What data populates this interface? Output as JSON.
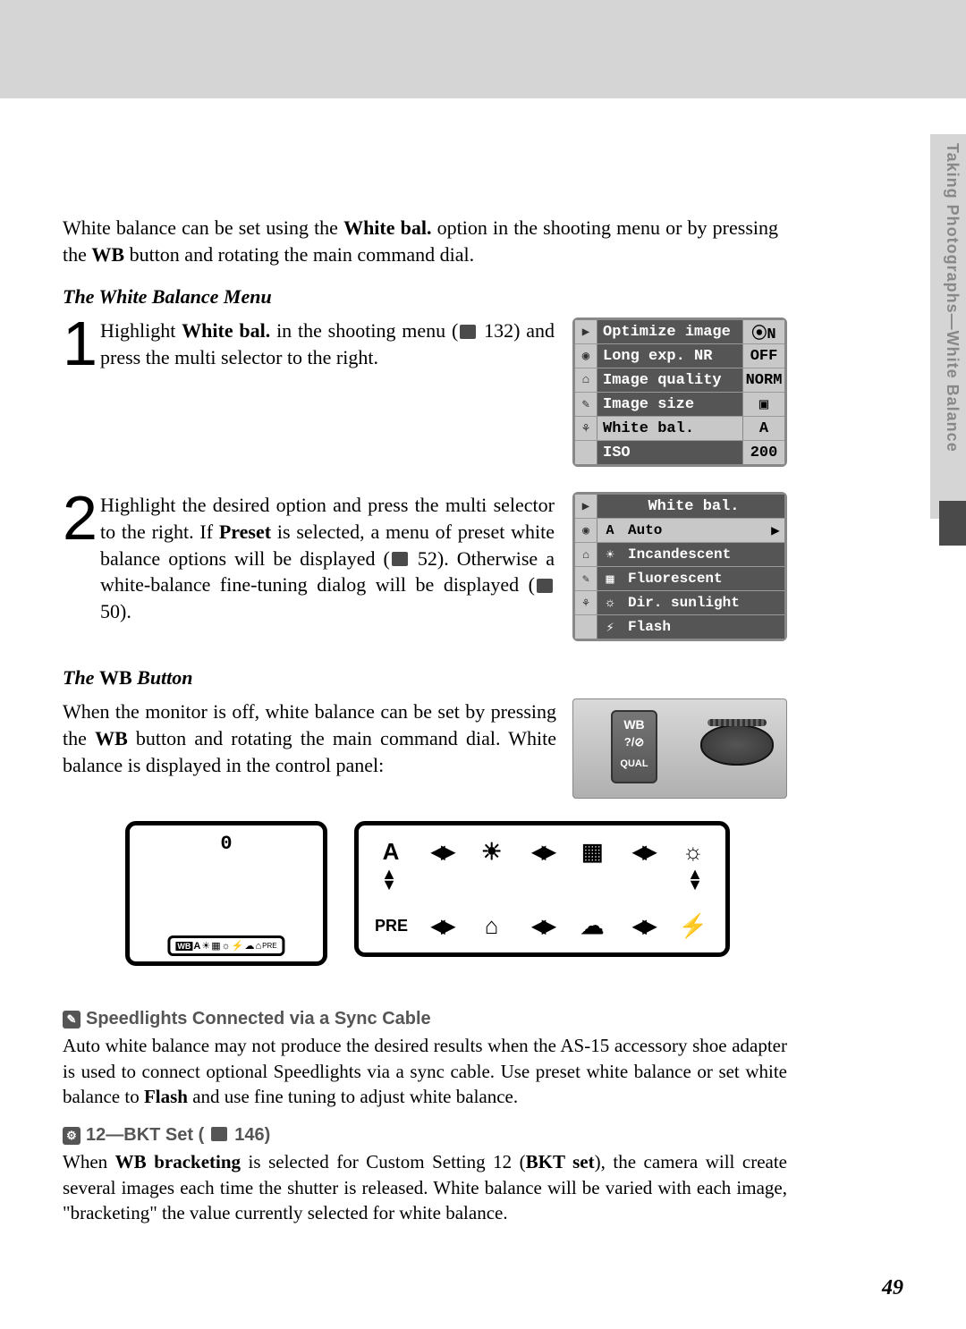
{
  "sideTab": "Taking Photographs—White Balance",
  "intro_a": "White balance can be set using the ",
  "intro_b": "White bal.",
  "intro_c": " option in the shooting menu or by pressing the ",
  "intro_d": "WB",
  "intro_e": " button and rotating the main command dial.",
  "section1": "The White Balance Menu",
  "step1_a": "Highlight ",
  "step1_b": "White bal.",
  "step1_c": " in the shooting menu (",
  "step1_d": " 132) and press the multi selector to the right.",
  "step2_a": "Highlight the desired option and press the multi selector to the right.  If ",
  "step2_b": "Preset",
  "step2_c": " is selected, a menu of preset white balance options will be displayed (",
  "step2_d": " 52).  Otherwise a white-balance fine-tuning dialog will be displayed (",
  "step2_e": " 50).",
  "menu1": {
    "r1": {
      "icon": "▶",
      "label": "Optimize image",
      "val": "⦿N"
    },
    "r2": {
      "icon": "◉",
      "label": "Long exp. NR",
      "val": "OFF"
    },
    "r3": {
      "icon": "⌂",
      "label": "Image quality",
      "val": "NORM"
    },
    "r4": {
      "icon": "✎",
      "label": "Image size",
      "val": "▣"
    },
    "r5": {
      "icon": "⚘",
      "label": "White bal.",
      "val": "A"
    },
    "r6": {
      "icon": "",
      "label": "ISO",
      "val": "200"
    }
  },
  "menu2": {
    "header": "White bal.",
    "side": {
      "s1": "▶",
      "s2": "◉",
      "s3": "⌂",
      "s4": "✎",
      "s5": "⚘"
    },
    "o1": {
      "icon": "A",
      "label": "Auto",
      "arrow": "▶"
    },
    "o2": {
      "icon": "☀",
      "label": "Incandescent"
    },
    "o3": {
      "icon": "▦",
      "label": "Fluorescent"
    },
    "o4": {
      "icon": "☼",
      "label": "Dir. sunlight"
    },
    "o5": {
      "icon": "⚡",
      "label": "Flash"
    }
  },
  "section2_a": "The ",
  "section2_b": "WB",
  "section2_c": " Button",
  "wb_body_a": "When the monitor is off, white balance can be set by pressing the ",
  "wb_body_b": "WB",
  "wb_body_c": " button and rotating the main command dial.  White balance is displayed in the control panel:",
  "wbBtn": {
    "top": "WB",
    "mid": "?/⊘",
    "bot": "QUAL"
  },
  "cycle": {
    "topA": "A",
    "topB": "☀",
    "topC": "▦",
    "topD": "☼",
    "botA": "PRE",
    "botB": "⌂",
    "botC": "☁",
    "botD": "⚡"
  },
  "cp": {
    "zero": "0",
    "wbtag": "WB",
    "a": "A",
    "pre": "PRE"
  },
  "note1_title": "Speedlights Connected via a Sync Cable",
  "note1_a": "Auto white balance may not produce the desired results when the AS-15 accessory shoe adapter is used to connect optional Speedlights via a sync cable.  Use preset white balance or set white balance to ",
  "note1_b": "Flash",
  "note1_c": " and use fine tuning to adjust white balance.",
  "note2_title": "12—BKT Set (",
  "note2_title_b": " 146)",
  "note2_a": "When ",
  "note2_b": "WB bracketing",
  "note2_c": " is selected for Custom Setting 12 (",
  "note2_d": "BKT set",
  "note2_e": "), the camera will create several images each time the shutter is released.  White balance will be varied with each image, \"bracketing\" the value currently selected for white balance.",
  "pageNum": "49"
}
